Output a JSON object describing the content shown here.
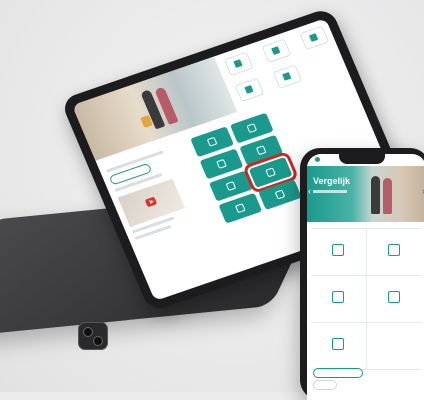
{
  "phone": {
    "hero_title": "Vergelijk"
  },
  "colors": {
    "accent": "#1a9a8c",
    "highlight": "#d0261f"
  }
}
